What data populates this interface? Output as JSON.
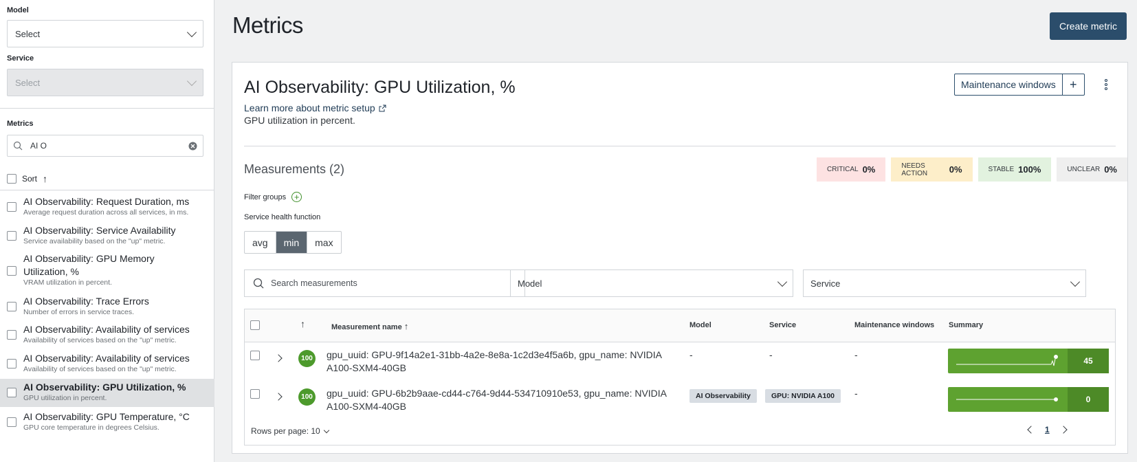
{
  "sidebar": {
    "model_label": "Model",
    "model_select": "Select",
    "service_label": "Service",
    "service_select": "Select",
    "metrics_label": "Metrics",
    "search_value": "AI O",
    "sort_label": "Sort",
    "items": [
      {
        "title": "AI Observability: Request Duration, ms",
        "desc": "Average request duration across all services, in ms."
      },
      {
        "title": "AI Observability: Service Availability",
        "desc": "Service availability based on the \"up\" metric."
      },
      {
        "title": "AI Observability: GPU Memory Utilization, %",
        "desc": "VRAM utilization in percent."
      },
      {
        "title": "AI Observability: Trace Errors",
        "desc": "Number of errors in service traces."
      },
      {
        "title": "AI Observability: Availability of services",
        "desc": "Availability of services based on the \"up\" metric."
      },
      {
        "title": "AI Observability: Availability of services",
        "desc": "Availability of services based on the \"up\" metric."
      },
      {
        "title": "AI Observability: GPU Utilization, %",
        "desc": "GPU utilization in percent.",
        "active": true
      },
      {
        "title": "AI Observability: GPU Temperature, °C",
        "desc": "GPU core temperature in degrees Celsius."
      }
    ]
  },
  "header": {
    "title": "Metrics",
    "create_button": "Create metric"
  },
  "panel": {
    "title": "AI Observability: GPU Utilization, %",
    "learn_link": "Learn more about metric setup",
    "description": "GPU utilization in percent.",
    "maintenance_button": "Maintenance windows",
    "maintenance_add": "+",
    "measurements_title": "Measurements (2)",
    "status": {
      "critical_label": "critical",
      "critical_value": "0%",
      "needs_label": "needs action",
      "needs_value": "0%",
      "stable_label": "stable",
      "stable_value": "100%",
      "unclear_label": "unclear",
      "unclear_value": "0%"
    },
    "filter_groups": "Filter groups",
    "health_function_label": "Service health function",
    "health_options": [
      "avg",
      "min",
      "max"
    ],
    "health_selected": "min",
    "search_placeholder": "Search measurements",
    "model_filter": "Model",
    "service_filter": "Service"
  },
  "table": {
    "headers": {
      "sort_arrow": "↑",
      "name": "Measurement name",
      "model": "Model",
      "service": "Service",
      "maintenance": "Maintenance windows",
      "summary": "Summary"
    },
    "rows": [
      {
        "score": "100",
        "name": "gpu_uuid: GPU-9f14a2e1-31bb-4a2e-8e8a-1c2d3e4f5a6b, gpu_name: NVIDIA A100-SXM4-40GB",
        "model": "-",
        "service": "-",
        "maintenance": "-",
        "summary_value": "45"
      },
      {
        "score": "100",
        "name": "gpu_uuid: GPU-6b2b9aae-cd44-c764-9d44-534710910e53, gpu_name: NVIDIA A100-SXM4-40GB",
        "model": "AI Observability",
        "service": "GPU: NVIDIA A100",
        "maintenance": "-",
        "summary_value": "0"
      }
    ],
    "rows_per_page": "Rows per page: 10",
    "page": "1"
  },
  "colors": {
    "primary": "#2b4d6b",
    "success": "#5ea230",
    "critical_bg": "#fde2e2",
    "needs_bg": "#fdeec9",
    "stable_bg": "#e2f2df"
  }
}
